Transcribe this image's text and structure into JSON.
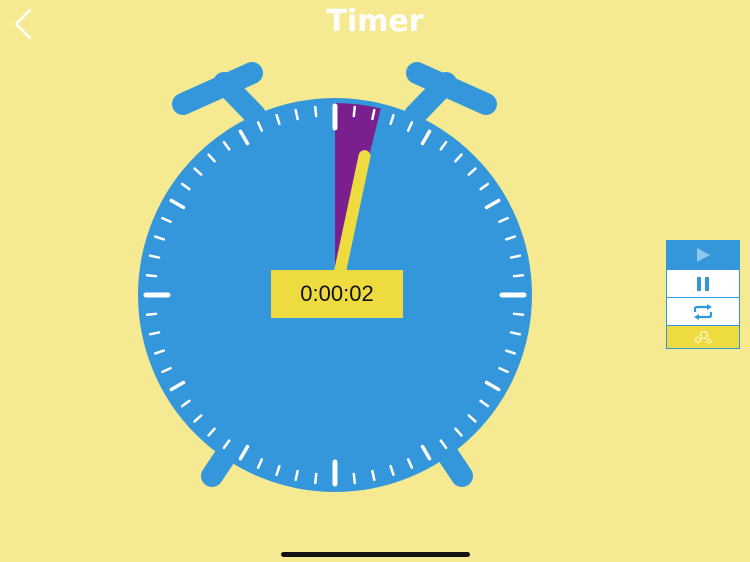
{
  "header": {
    "title": "Timer",
    "back_icon": "chevron-left-icon"
  },
  "timer": {
    "elapsed_display": "0:00:02",
    "elapsed_seconds": 2,
    "elapsed_sector_minutes": 2.3,
    "hand_minutes": 2
  },
  "controls": {
    "play_icon": "play-icon",
    "pause_icon": "pause-icon",
    "repeat_icon": "repeat-icon",
    "settings_icon": "settings-icon"
  },
  "colors": {
    "background": "#F5EA92",
    "clock_face": "#3497DB",
    "elapsed_sector": "#7B1E8E",
    "hand_and_readout": "#EEDB3F",
    "tick_marks": "#ffffff"
  }
}
